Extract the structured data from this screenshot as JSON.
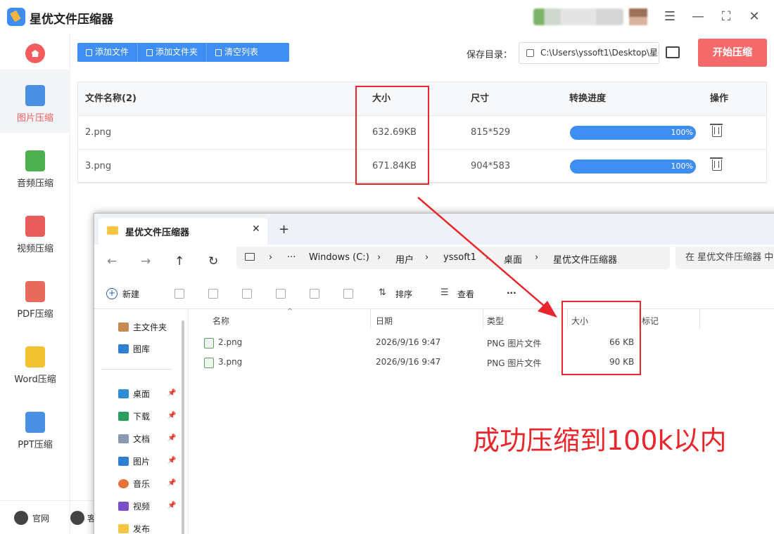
{
  "app": {
    "title": "星优文件压缩器",
    "window_controls": [
      "☰",
      "—",
      "⛶",
      "✕"
    ]
  },
  "sidebar": {
    "items": [
      {
        "label": "图片压缩",
        "active": true,
        "color": "#4a90e2"
      },
      {
        "label": "音频压缩",
        "active": false,
        "color": "#4caf50"
      },
      {
        "label": "视频压缩",
        "active": false,
        "color": "#e85c5c"
      },
      {
        "label": "PDF压缩",
        "active": false,
        "color": "#e86a5c"
      },
      {
        "label": "Word压缩",
        "active": false,
        "color": "#f2c230"
      },
      {
        "label": "PPT压缩",
        "active": false,
        "color": "#4a90e2"
      }
    ],
    "bottom": {
      "website_label": "官网",
      "service_label": "客"
    }
  },
  "toolbar": {
    "add_file": "添加文件",
    "add_folder": "添加文件夹",
    "clear_list": "清空列表",
    "save_label": "保存目录：",
    "save_path": "C:\\Users\\yssoft1\\Desktop\\星",
    "start_button": "开始压缩"
  },
  "file_table": {
    "headers": [
      "文件名称(2)",
      "大小",
      "尺寸",
      "转换进度",
      "操作"
    ],
    "rows": [
      {
        "name": "2.png",
        "size": "632.69KB",
        "dimensions": "815*529",
        "progress": "100%"
      },
      {
        "name": "3.png",
        "size": "671.84KB",
        "dimensions": "904*583",
        "progress": "100%"
      }
    ]
  },
  "explorer": {
    "tab_title": "星优文件压缩器",
    "new_tab": "+",
    "breadcrumb": [
      "Windows (C:)",
      "用户",
      "yssoft1",
      "桌面",
      "星优文件压缩器"
    ],
    "search_placeholder": "在 星优文件压缩器 中",
    "commands": {
      "new": "新建",
      "sort": "排序",
      "view": "查看",
      "more": "···"
    },
    "nav_pane": {
      "top": [
        "主文件夹",
        "图库"
      ],
      "pinned": [
        "桌面",
        "下载",
        "文档",
        "图片",
        "音乐",
        "视频",
        "发布"
      ]
    },
    "columns": [
      "名称",
      "日期",
      "类型",
      "大小",
      "标记"
    ],
    "files": [
      {
        "name": "2.png",
        "date": "2026/9/16 9:47",
        "type": "PNG 图片文件",
        "size": "66 KB"
      },
      {
        "name": "3.png",
        "date": "2026/9/16 9:47",
        "type": "PNG 图片文件",
        "size": "90 KB"
      }
    ]
  },
  "annotation": {
    "caption": "成功压缩到100k以内",
    "color": "#e8262b"
  },
  "colors": {
    "accent": "#3d8ef0",
    "start": "#f46a6a"
  }
}
